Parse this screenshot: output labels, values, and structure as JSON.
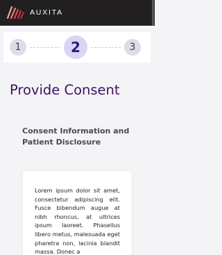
{
  "header": {
    "brand": "AUXITA",
    "logo_icon": "auxita-logo-icon",
    "colors": {
      "background": "#211f20",
      "logo_stripes": [
        "#f2a3a5",
        "#e7444e",
        "#c31f3c"
      ]
    }
  },
  "stepper": {
    "steps": [
      {
        "label": "1",
        "state": "inactive"
      },
      {
        "label": "2",
        "state": "active"
      },
      {
        "label": "3",
        "state": "inactive"
      }
    ],
    "current_step": 2,
    "colors": {
      "active_fill": "#dcd4f3",
      "active_text": "#2b1d7c",
      "inactive_fill": "#dcdde6"
    }
  },
  "main": {
    "title": "Provide Consent",
    "subtitle": "Consent Information and Patient Disclosure",
    "body_text": "Lorem ipsum dolor sit amet, consectetur adipiscing elit. Fusce bibendum augue at nibh rhoncus, at ultrices ipsum laoreet. Phasellus libero metus, malesuada eget pharetra non, lacinia blandit massa. Donec a",
    "title_color": "#3e1462"
  }
}
